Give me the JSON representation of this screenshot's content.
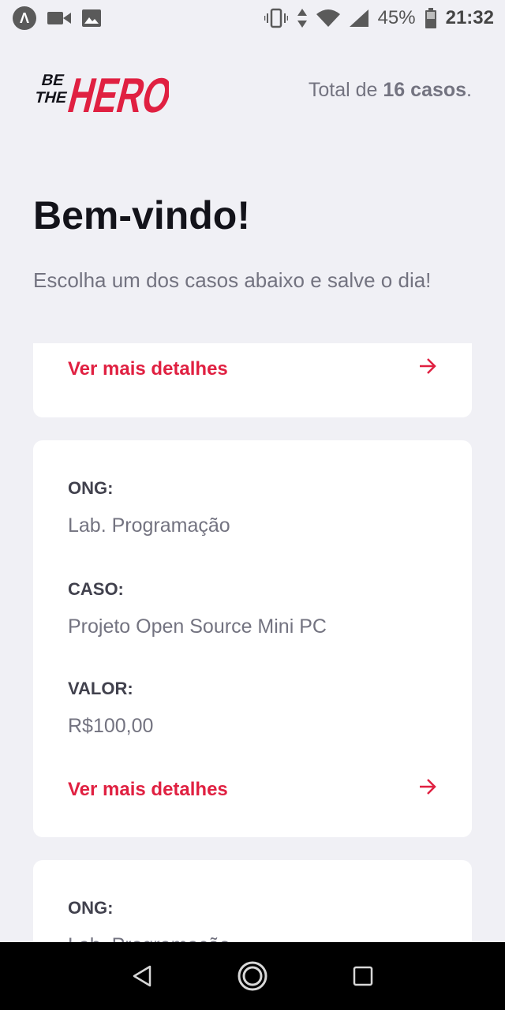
{
  "status_bar": {
    "app_icon_letter": "Λ",
    "battery_percent": "45%",
    "time": "21:32",
    "icons": [
      "app-icon",
      "video-camera-icon",
      "image-icon",
      "vibrate-icon",
      "data-transfer-icon",
      "wifi-icon",
      "cell-signal-icon",
      "battery-icon"
    ]
  },
  "header": {
    "logo_line1": "BE",
    "logo_line2": "THE",
    "logo_word": "HERO",
    "total_prefix": "Total de ",
    "total_count": "16 casos",
    "total_suffix": "."
  },
  "welcome": {
    "title": "Bem-vindo!",
    "subtitle": "Escolha um dos casos abaixo e salve o dia!"
  },
  "incidents": [
    {
      "details_label": "Ver mais detalhes"
    },
    {
      "ong_label": "ONG:",
      "ong_value": "Lab. Programação",
      "caso_label": "CASO:",
      "caso_value": "Projeto Open Source Mini PC",
      "valor_label": "VALOR:",
      "valor_value": "R$100,00",
      "details_label": "Ver mais detalhes"
    },
    {
      "ong_label": "ONG:",
      "ong_value": "Lab. Programação"
    }
  ],
  "colors": {
    "brand_red": "#e02041",
    "background": "#f0f0f5",
    "text_dark": "#13131a",
    "text_muted": "#737380",
    "label": "#41414d"
  },
  "nav_bar": {
    "icons": [
      "back-icon",
      "home-icon",
      "recents-icon"
    ]
  }
}
